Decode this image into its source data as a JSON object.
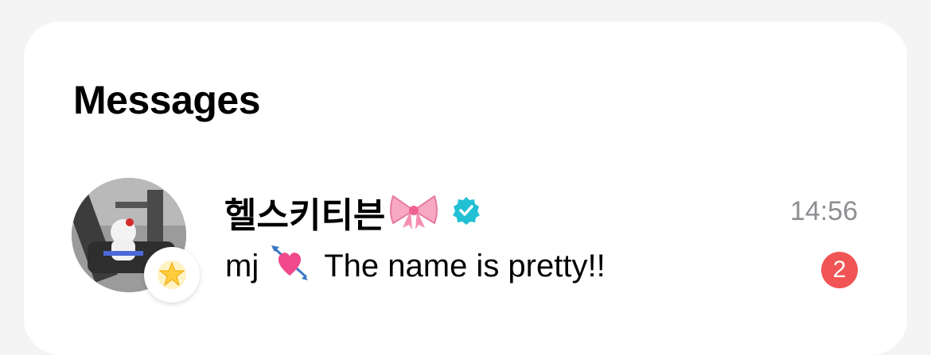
{
  "header": {
    "title": "Messages"
  },
  "conversation": {
    "name": "헬스키티븐",
    "name_emoji_icon": "bow-icon",
    "verified_icon": "verified-badge-icon",
    "time": "14:56",
    "sender": "mj",
    "message_emoji_icon": "heart-with-arrow-icon",
    "message": "The name is pretty!!",
    "unread_count": "2",
    "avatar_badge_icon": "star-icon"
  },
  "colors": {
    "verified": "#21c0d4",
    "unread_badge": "#f05454",
    "timestamp": "#8e8e93"
  }
}
